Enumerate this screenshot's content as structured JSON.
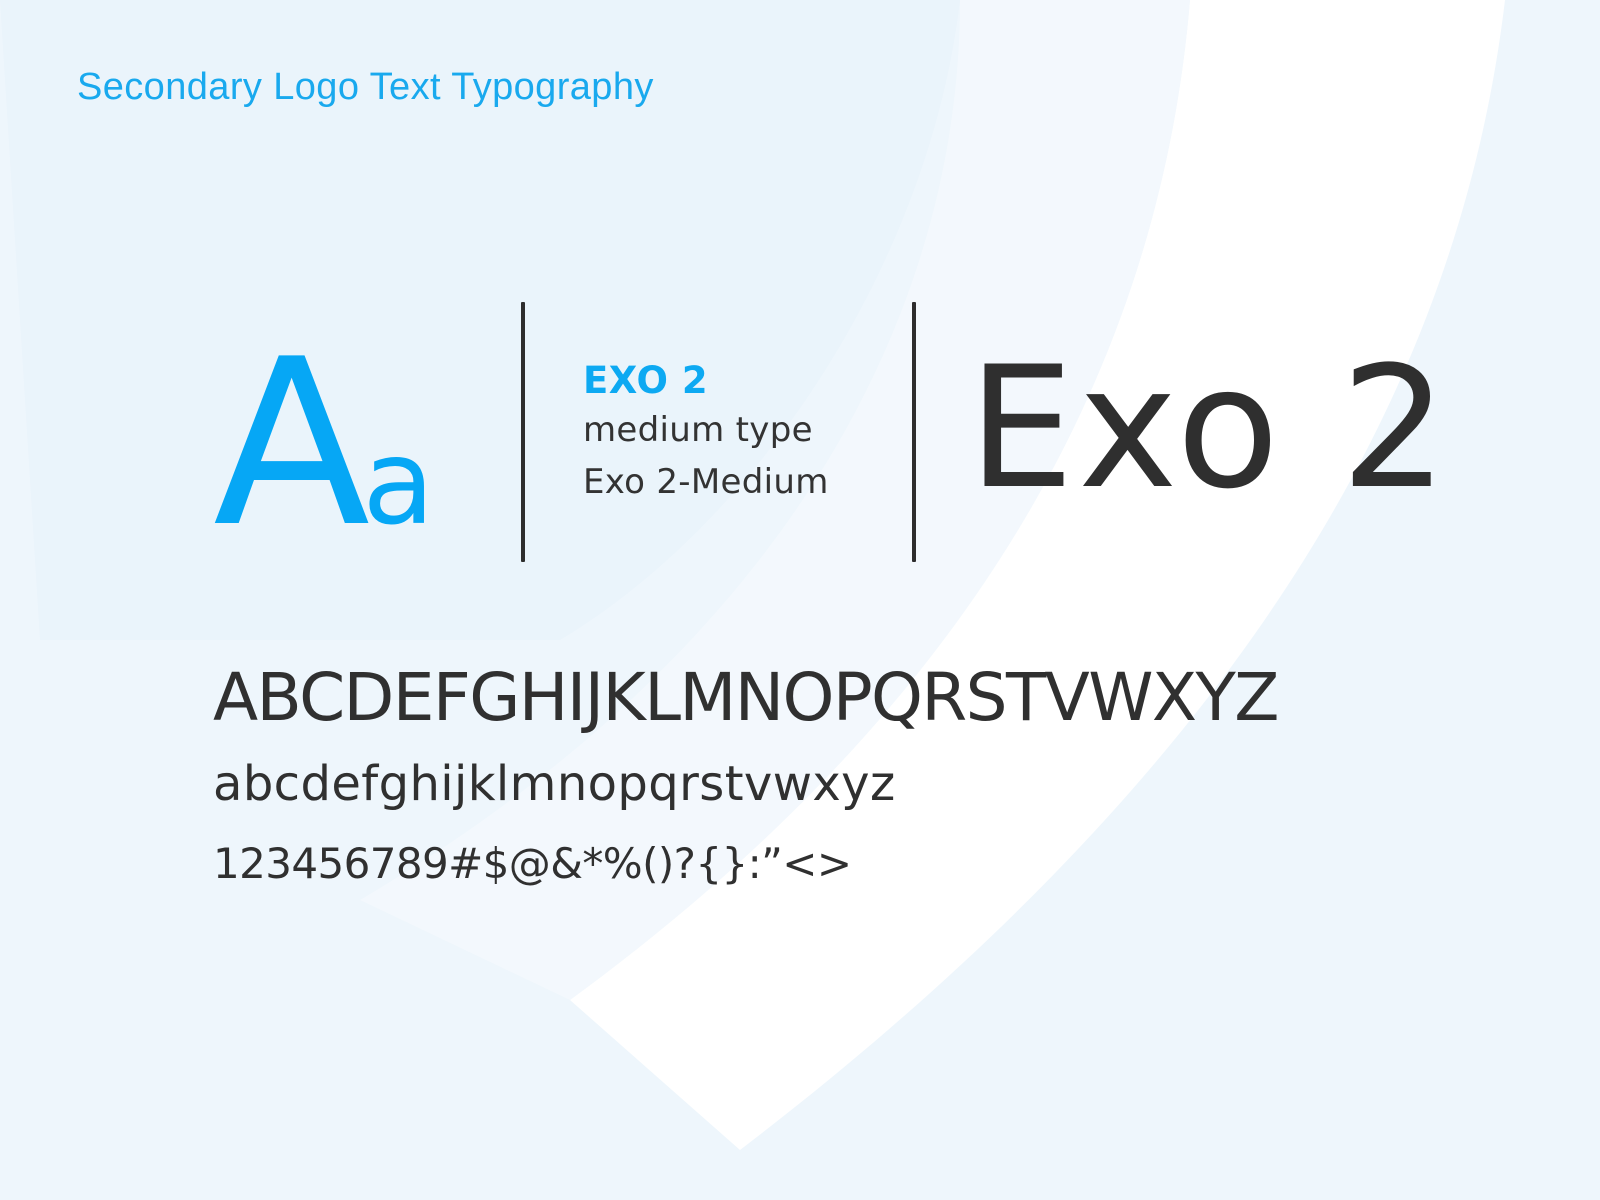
{
  "heading": "Secondary Logo Text Typography",
  "specimen": {
    "upper": "A",
    "lower": "a"
  },
  "font_info": {
    "name": "EXO 2",
    "weight": "medium type",
    "file": "Exo 2-Medium"
  },
  "display_name": "Exo 2",
  "charset": {
    "uppercase": "ABCDEFGHIJKLMNOPQRSTVWXYZ",
    "lowercase": "abcdefghijklmnopqrstvwxyz",
    "symbols": "123456789#$@&*%()?{}:”<>"
  },
  "colors": {
    "accent": "#06a7f5",
    "text": "#2f2f2f",
    "background": "#eef6fc"
  }
}
